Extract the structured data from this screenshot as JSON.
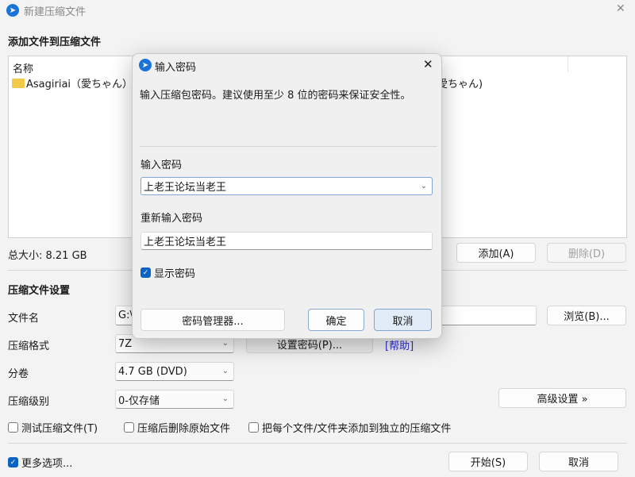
{
  "window": {
    "title": "新建压缩文件",
    "close": "✕"
  },
  "files": {
    "section_title": "添加文件到压缩文件",
    "column_name": "名称",
    "items": [
      {
        "name": "Asagiriai（愛ちゃん）",
        "path_partial": "愛ちゃん)"
      }
    ],
    "total_size": "总大小: 8.21 GB",
    "add": "添加(A)",
    "delete": "删除(D)"
  },
  "settings": {
    "section_title": "压缩文件设置",
    "filename_label": "文件名",
    "filename_value": "G:\\",
    "browse": "浏览(B)...",
    "format_label": "压缩格式",
    "format_value": "7Z",
    "set_password": "设置密码(P)...",
    "help": "[帮助]",
    "split_label": "分卷",
    "split_value": "4.7 GB (DVD)",
    "level_label": "压缩级别",
    "level_value": "0-仅存储",
    "advanced": "高级设置 »",
    "test": "测试压缩文件(T)",
    "test_checked": false,
    "delete_after": "压缩后删除原始文件",
    "delete_after_checked": false,
    "each_separate": "把每个文件/文件夹添加到独立的压缩文件",
    "each_separate_checked": false,
    "more_options": "更多选项...",
    "more_options_checked": true,
    "start": "开始(S)",
    "cancel": "取消"
  },
  "dialog": {
    "title": "输入密码",
    "close": "✕",
    "hint": "输入压缩包密码。建议使用至少 8 位的密码来保证安全性。",
    "password_label": "输入密码",
    "password_value": "上老王论坛当老王",
    "confirm_label": "重新输入密码",
    "confirm_value": "上老王论坛当老王",
    "show_password": "显示密码",
    "show_password_checked": true,
    "manager": "密码管理器...",
    "ok": "确定",
    "cancel": "取消"
  },
  "colors": {
    "accent": "#0b63c2",
    "link": "#2b2bd6"
  }
}
